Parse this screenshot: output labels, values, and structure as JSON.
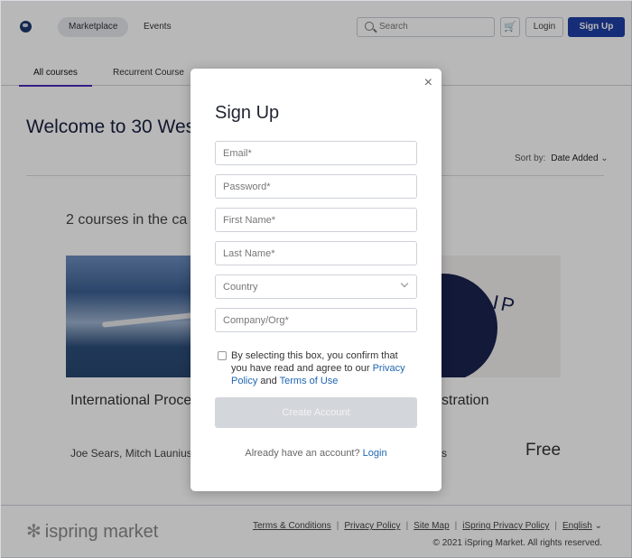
{
  "header": {
    "nav": [
      "Marketplace",
      "Events"
    ],
    "search_placeholder": "Search",
    "cart_icon": "cart-icon",
    "login_label": "Login",
    "signup_label": "Sign Up"
  },
  "tabs": [
    "All courses",
    "Recurrent Course"
  ],
  "main": {
    "welcome": "Welcome to 30 Wes",
    "sort_label": "Sort by:",
    "sort_value": "Date Added",
    "count": "2 courses in the ca",
    "cards": [
      {
        "title": "International Proce",
        "author": "Joe Sears, Mitch Launius"
      },
      {
        "title": "stration",
        "author": "s",
        "price": "Free",
        "logo_text": "EST IP"
      }
    ]
  },
  "footer": {
    "logo": "ispring market",
    "links": [
      "Terms & Conditions",
      "Privacy Policy",
      "Site Map",
      "iSpring Privacy Policy",
      "English"
    ],
    "copyright": "© 2021 iSpring Market. All rights reserved."
  },
  "modal": {
    "title": "Sign Up",
    "close": "×",
    "fields": [
      "Email*",
      "Password*",
      "First Name*",
      "Last Name*",
      "Country",
      "Company/Org*"
    ],
    "consent_text": "By selecting this box, you confirm that you have read and agree to our ",
    "privacy_link": "Privacy Policy",
    "and": " and ",
    "terms_link": "Terms of Use",
    "create_button": "Create Account",
    "have_account": "Already have an account? ",
    "login_link": "Login"
  },
  "colors": {
    "brand": "#1f3fa6",
    "link": "#2066b0",
    "tab_active": "#4a2bb8"
  }
}
